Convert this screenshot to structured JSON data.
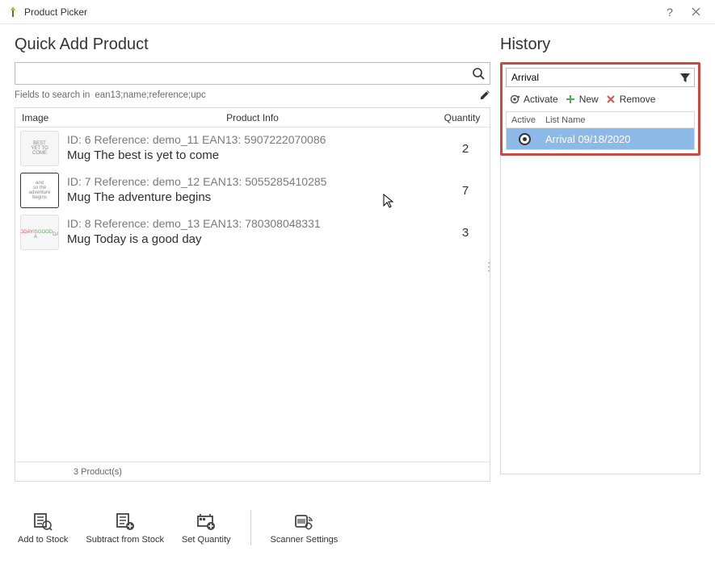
{
  "window": {
    "title": "Product Picker"
  },
  "left": {
    "title": "Quick Add Product",
    "search_value": "",
    "fields_label": "Fields to search in",
    "fields_value": "ean13;name;reference;upc",
    "columns": {
      "image": "Image",
      "info": "Product Info",
      "qty": "Quantity"
    },
    "rows": [
      {
        "meta": "ID: 6 Reference: demo_11 EAN13: 5907222070086",
        "name": "Mug The best is yet to come",
        "qty": "2"
      },
      {
        "meta": "ID: 7 Reference: demo_12 EAN13: 5055285410285",
        "name": "Mug The adventure begins",
        "qty": "7"
      },
      {
        "meta": "ID: 8 Reference: demo_13 EAN13: 780308048331",
        "name": "Mug Today is a good day",
        "qty": "3"
      }
    ],
    "footer_count": "3 Product(s)"
  },
  "right": {
    "title": "History",
    "search_value": "Arrival",
    "actions": {
      "activate": "Activate",
      "new": "New",
      "remove": "Remove"
    },
    "columns": {
      "active": "Active",
      "name": "List Name"
    },
    "rows": [
      {
        "name": "Arrival 09/18/2020",
        "active": true
      }
    ]
  },
  "toolbar": {
    "add": "Add to Stock",
    "subtract": "Subtract from Stock",
    "setqty": "Set Quantity",
    "scanner": "Scanner Settings"
  }
}
